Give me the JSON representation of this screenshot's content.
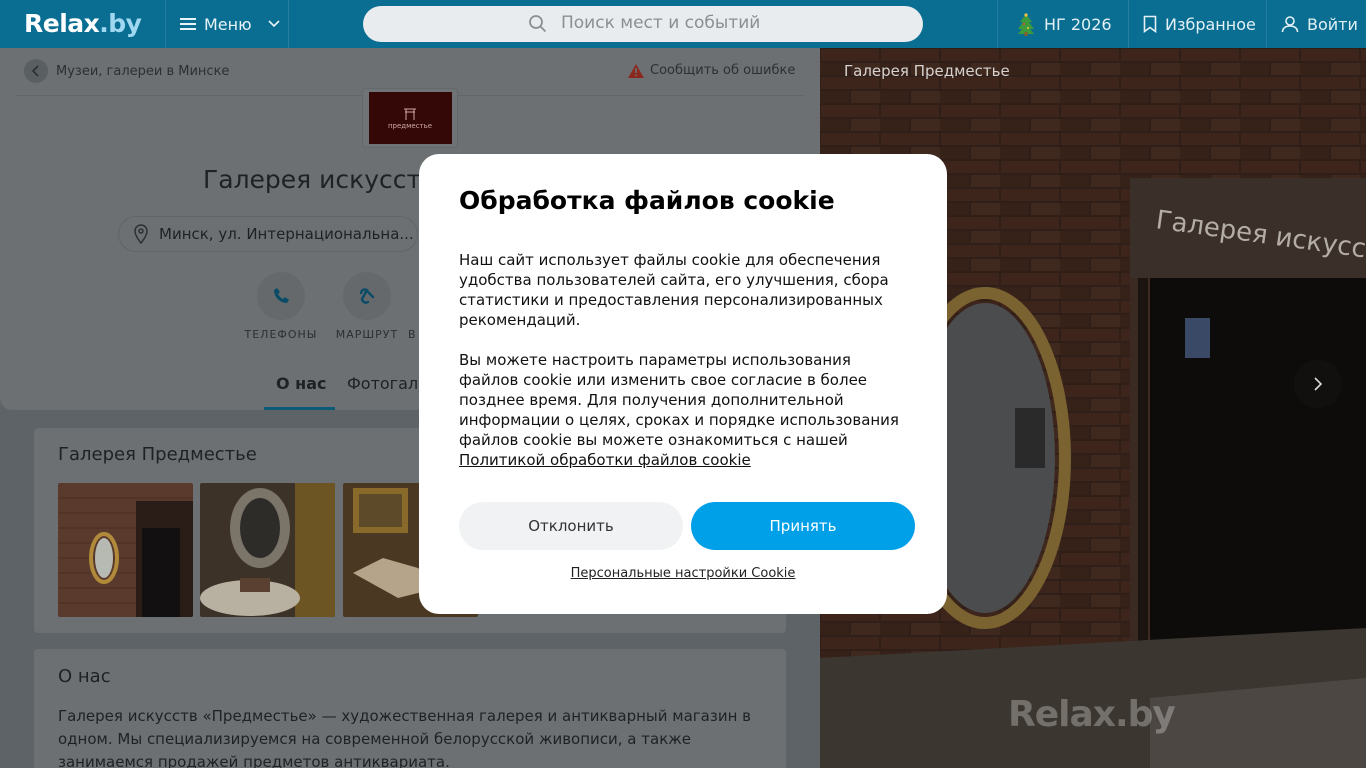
{
  "header": {
    "logo": "Relax",
    "logo_suffix": ".by",
    "menu_label": "Меню",
    "search_placeholder": "Поиск мест и событий",
    "ng_label": "НГ 2026",
    "favorites_label": "Избранное",
    "login_label": "Войти"
  },
  "breadcrumb": {
    "label": "Музеи, галереи в Минске"
  },
  "report_label": "Сообщить об ошибке",
  "org": {
    "logo_text": "предместье",
    "title": "Галерея искусств",
    "address": "Минск, ул. Интернациональна..."
  },
  "actions": [
    {
      "label": "ТЕЛЕФОНЫ",
      "icon": "phone-icon"
    },
    {
      "label": "МАРШРУТ",
      "icon": "route-icon"
    },
    {
      "label": "В",
      "icon": "more-icon"
    }
  ],
  "tabs": [
    {
      "label": "О нас",
      "active": true
    },
    {
      "label": "Фотогале",
      "active": false
    }
  ],
  "gallery_card": {
    "title": "Галерея Предместье"
  },
  "about": {
    "title": "О нас",
    "text": "Галерея искусств «Предместье» — художественная галерея и антикварный магазин в одном. Мы специализируемся на современной белорусской живописи, а также занимаемся продажей предметов антиквариата."
  },
  "photo": {
    "title": "Галерея Предместье",
    "watermark": "Relax.by",
    "sign_text": "Галерея искусств"
  },
  "cookie_modal": {
    "title": "Обработка файлов cookie",
    "paragraph1": "Наш сайт использует файлы cookie для обеспечения удобства пользователей сайта, его улучшения, сбора статистики и предоставления персонализированных рекомендаций.",
    "paragraph2": "Вы можете настроить параметры использования файлов cookie или изменить свое согласие в более позднее время. Для получения дополнительной информации о целях, сроках и порядке использования файлов cookie вы можете ознакомиться с нашей",
    "policy_link": "Политикой обработки файлов cookie",
    "decline_label": "Отклонить",
    "accept_label": "Принять",
    "settings_link": "Персональные настройки Cookie"
  },
  "colors": {
    "header_bg": "#0a6e92",
    "accept_bg": "#00a0e9",
    "decline_bg": "#f1f2f3"
  }
}
